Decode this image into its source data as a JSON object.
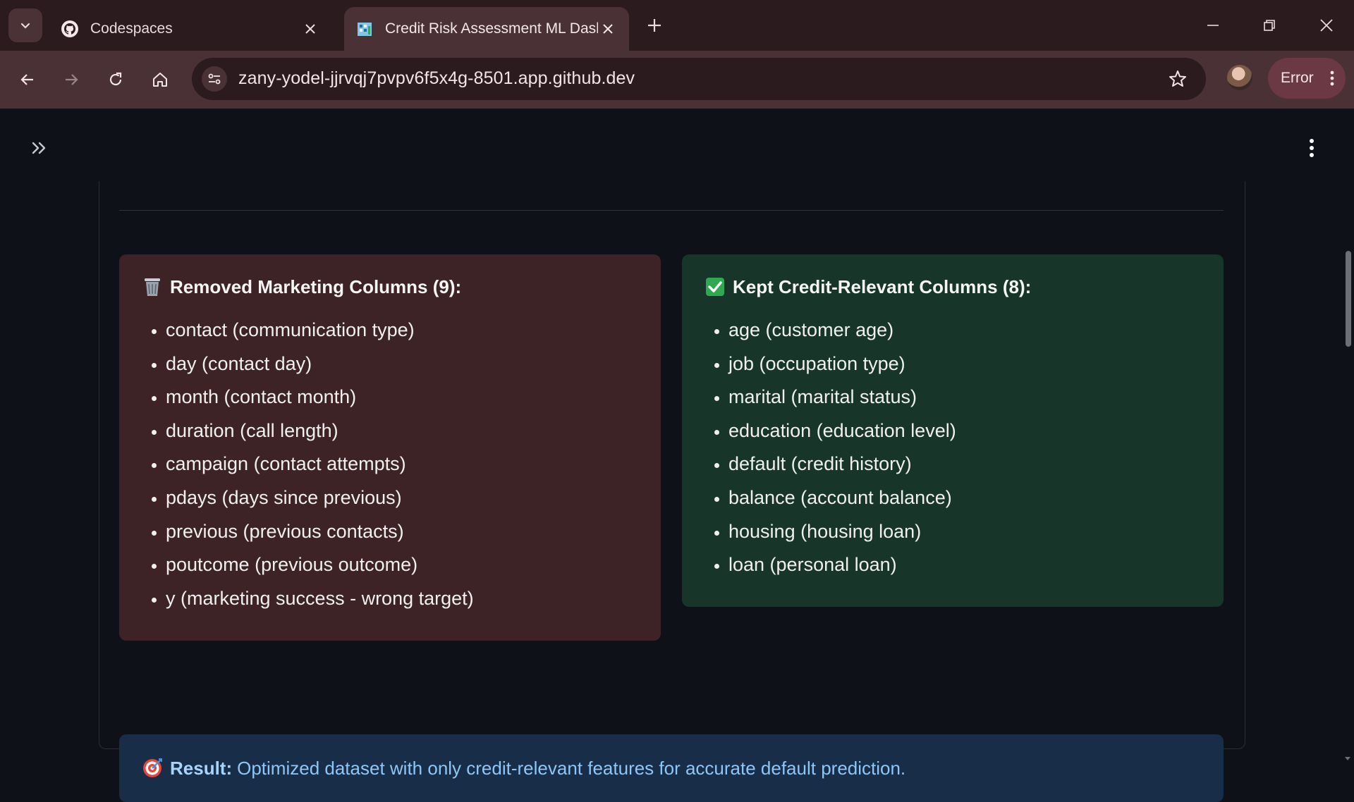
{
  "browser": {
    "tabs": [
      {
        "label": "Codespaces",
        "favicon": "github-icon"
      },
      {
        "label": "Credit Risk Assessment ML Dashboard",
        "favicon": "app-favicon-icon"
      }
    ],
    "url": "zany-yodel-jjrvqj7pvpv6f5x4g-8501.app.github.dev",
    "error_label": "Error",
    "accent": "#4a3136"
  },
  "removed": {
    "title": "Removed Marketing Columns (9):",
    "icon": "wastebasket-icon",
    "items": [
      "contact (communication type)",
      "day (contact day)",
      "month (contact month)",
      "duration (call length)",
      "campaign (contact attempts)",
      "pdays (days since previous)",
      "previous (previous contacts)",
      "poutcome (previous outcome)",
      "y (marketing success - wrong target)"
    ],
    "color": "#3d2326"
  },
  "kept": {
    "title": "Kept Credit-Relevant Columns (8):",
    "icon": "check-mark-icon",
    "items": [
      "age (customer age)",
      "job (occupation type)",
      "marital (marital status)",
      "education (education level)",
      "default (credit history)",
      "balance (account balance)",
      "housing (housing loan)",
      "loan (personal loan)"
    ],
    "color": "#173528"
  },
  "result": {
    "icon": "target-icon",
    "label": "Result:",
    "text": "Optimized dataset with only credit-relevant features for accurate default prediction.",
    "color": "#172d48"
  }
}
